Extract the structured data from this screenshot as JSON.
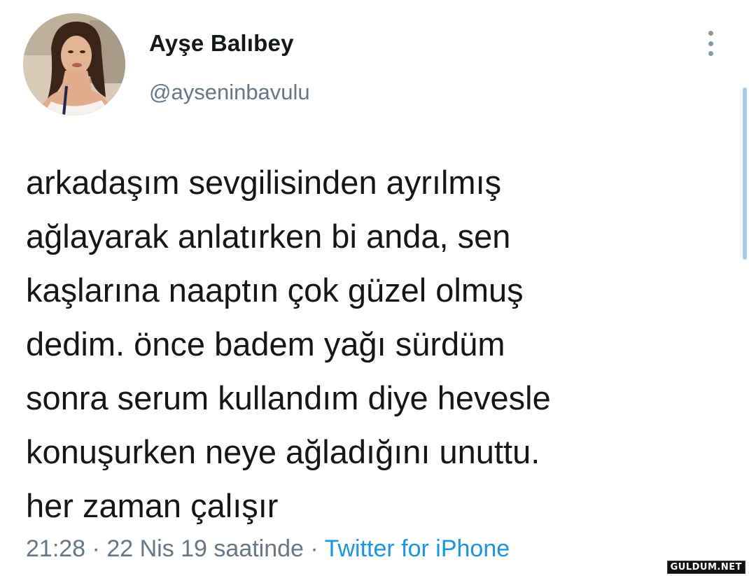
{
  "tweet": {
    "author": {
      "display_name": "Ayşe Balıbey",
      "handle": "@ayseninbavulu"
    },
    "text_lines": [
      "arkadaşım sevgilisinden ayrılmış",
      "ağlayarak anlatırken bi anda, sen",
      "kaşlarına naaptın çok güzel olmuş",
      "dedim. önce badem yağı sürdüm",
      "sonra serum kullandım diye hevesle",
      "konuşurken neye ağladığını unuttu.",
      "her zaman çalışır"
    ],
    "time": "21:28",
    "separator": "·",
    "date": "22 Nis 19 saatinde",
    "source": "Twitter for iPhone"
  },
  "watermark": "GULDUM.NET",
  "icons": {
    "more": "more-vertical-icon"
  },
  "colors": {
    "text": "#14171a",
    "secondary": "#657786",
    "link": "#1b95e0"
  }
}
